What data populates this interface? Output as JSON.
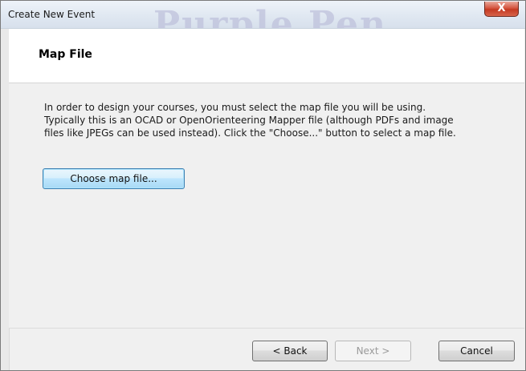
{
  "window": {
    "title": "Create New Event",
    "background_title": "Purple Pen",
    "close_label": "X"
  },
  "header": {
    "title": "Map File"
  },
  "content": {
    "description_line1": "In order to design your courses, you must select the map file you will be using.",
    "description_line2": "Typically this is an OCAD or OpenOrienteering Mapper file (although PDFs and image",
    "description_line3": "files like JPEGs can be used instead). Click the \"Choose...\" button to select a map file.",
    "choose_button_label": "Choose map file..."
  },
  "footer": {
    "back_label": "< Back",
    "next_label": "Next >",
    "cancel_label": "Cancel"
  },
  "colors": {
    "close_button": "#c43a22",
    "focus_button_border": "#3c7fb1",
    "disabled_text": "#9a9a9a"
  }
}
